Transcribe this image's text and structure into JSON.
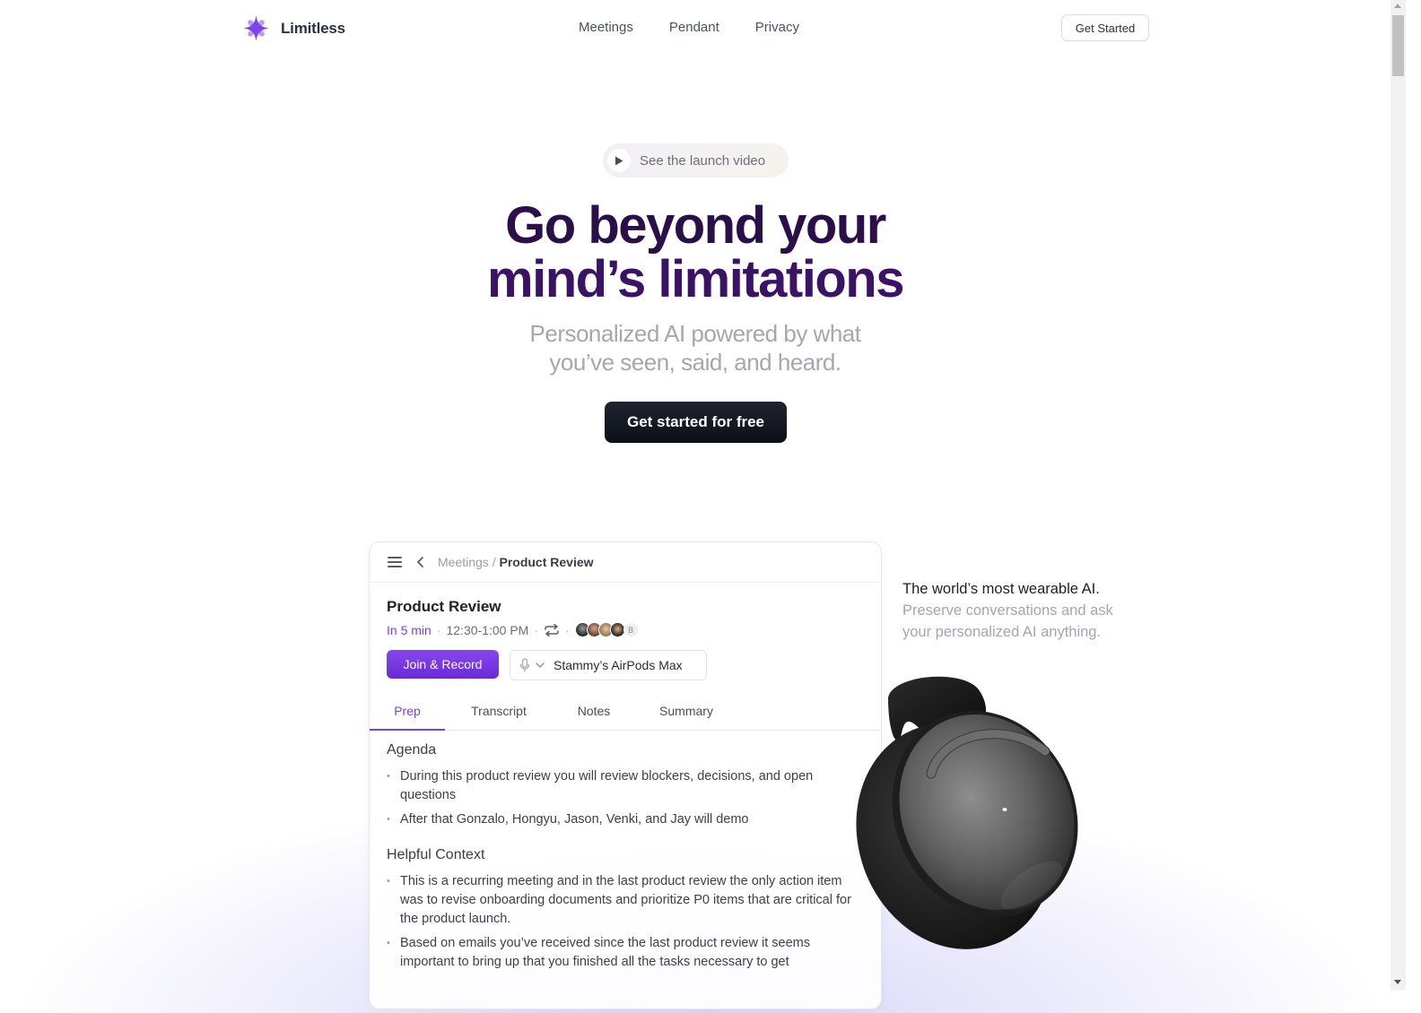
{
  "nav": {
    "brand": "Limitless",
    "links": [
      "Meetings",
      "Pendant",
      "Privacy"
    ],
    "cta_label": "Get Started"
  },
  "hero": {
    "launch_video_label": "See the launch video",
    "headline_lines": [
      "Go beyond your",
      "mind’s limitations"
    ],
    "subhead_lines": [
      "Personalized AI powered by what",
      "you’ve seen, said, and heard."
    ],
    "cta_label": "Get started for free"
  },
  "app": {
    "breadcrumb": {
      "parent": "Meetings",
      "separator": "/",
      "current": "Product Review"
    },
    "meeting": {
      "title": "Product Review",
      "starts_in": "In 5 min",
      "time_range": "12:30-1:00 PM",
      "extra_attendee_initial": "B"
    },
    "join_label": "Join & Record",
    "audio_device": "Stammy’s AirPods Max",
    "tabs": [
      {
        "label": "Prep",
        "active": true
      },
      {
        "label": "Transcript",
        "active": false
      },
      {
        "label": "Notes",
        "active": false
      },
      {
        "label": "Summary",
        "active": false
      }
    ],
    "sections": [
      {
        "heading": "Agenda",
        "items": [
          "During this product review you will review blockers, decisions, and open questions",
          "After that Gonzalo, Hongyu, Jason, Venki, and Jay will demo"
        ]
      },
      {
        "heading": "Helpful Context",
        "items": [
          "This is a recurring meeting and in the last product review the only action item was to revise onboarding documents and prioritize P0 items that are critical for the product launch.",
          "Based on emails you’ve received since the last product review it seems important to bring up that you finished all the tasks necessary to get"
        ]
      }
    ]
  },
  "tagline": {
    "main": "The world’s most wearable AI.",
    "sub": "Preserve conversations and ask your personalized AI anything."
  },
  "colors": {
    "brand_purple": "#7b3fe4",
    "headline": "#2a0f4a",
    "cta_dark": "#0c0f17"
  }
}
